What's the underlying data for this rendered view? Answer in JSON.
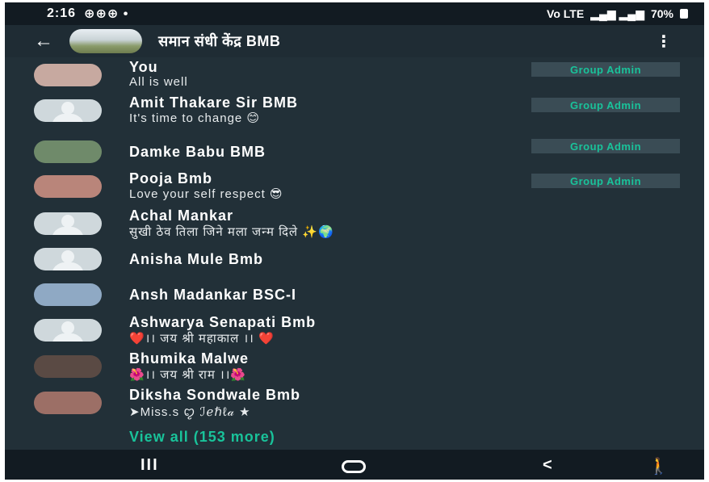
{
  "status_bar": {
    "time": "2:16",
    "notification_icons": "⊕⊕⊕ •",
    "signal_text": "Vo LTE",
    "battery": "70%"
  },
  "header": {
    "group_name": "समान संधी केंद्र BMB"
  },
  "members": [
    {
      "name": "You",
      "about": "All is well",
      "badge": "Group Admin",
      "avatar": "photo",
      "avatar_color": "#c7a9a0"
    },
    {
      "name": "Amit Thakare Sir BMB",
      "about": "It's time to change 😊",
      "badge": "Group Admin",
      "avatar": "default",
      "avatar_color": "#cfd8dc"
    },
    {
      "name": "Damke Babu BMB",
      "about": "",
      "badge": "Group Admin",
      "avatar": "photo",
      "avatar_color": "#6f8a6a"
    },
    {
      "name": "Pooja Bmb",
      "about": "Love your self respect 😎",
      "badge": "Group Admin",
      "avatar": "photo",
      "avatar_color": "#b9857a"
    },
    {
      "name": "Achal Mankar",
      "about": "सुखी ठेव तिला जिने मला जन्म दिले ✨🌍",
      "badge": "",
      "avatar": "default",
      "avatar_color": "#cfd8dc"
    },
    {
      "name": "Anisha Mule Bmb",
      "about": "",
      "badge": "",
      "avatar": "default",
      "avatar_color": "#cfd8dc"
    },
    {
      "name": "Ansh Madankar BSC-I",
      "about": "",
      "badge": "",
      "avatar": "photo",
      "avatar_color": "#8fa9c4"
    },
    {
      "name": "Ashwarya Senapati Bmb",
      "about": "❤️।। जय श्री महाकाल ।। ❤️",
      "badge": "",
      "avatar": "default",
      "avatar_color": "#cfd8dc"
    },
    {
      "name": "Bhumika Malwe",
      "about": "🌺।। जय श्री राम ।।🌺",
      "badge": "",
      "avatar": "photo",
      "avatar_color": "#5a4a44"
    },
    {
      "name": "Diksha Sondwale Bmb",
      "about": "➤Miss.s ꨄ ℐℯℏℓ𝒶 ★",
      "badge": "",
      "avatar": "photo",
      "avatar_color": "#9c6f66"
    }
  ],
  "view_all": "View all (153 more)",
  "nav": {
    "recents": "III",
    "back": "<",
    "accessibility": "🚶"
  },
  "colors": {
    "background": "#223038",
    "header": "#1f2c34",
    "accent": "#19c39a",
    "badge_bg": "#3a4c55"
  }
}
